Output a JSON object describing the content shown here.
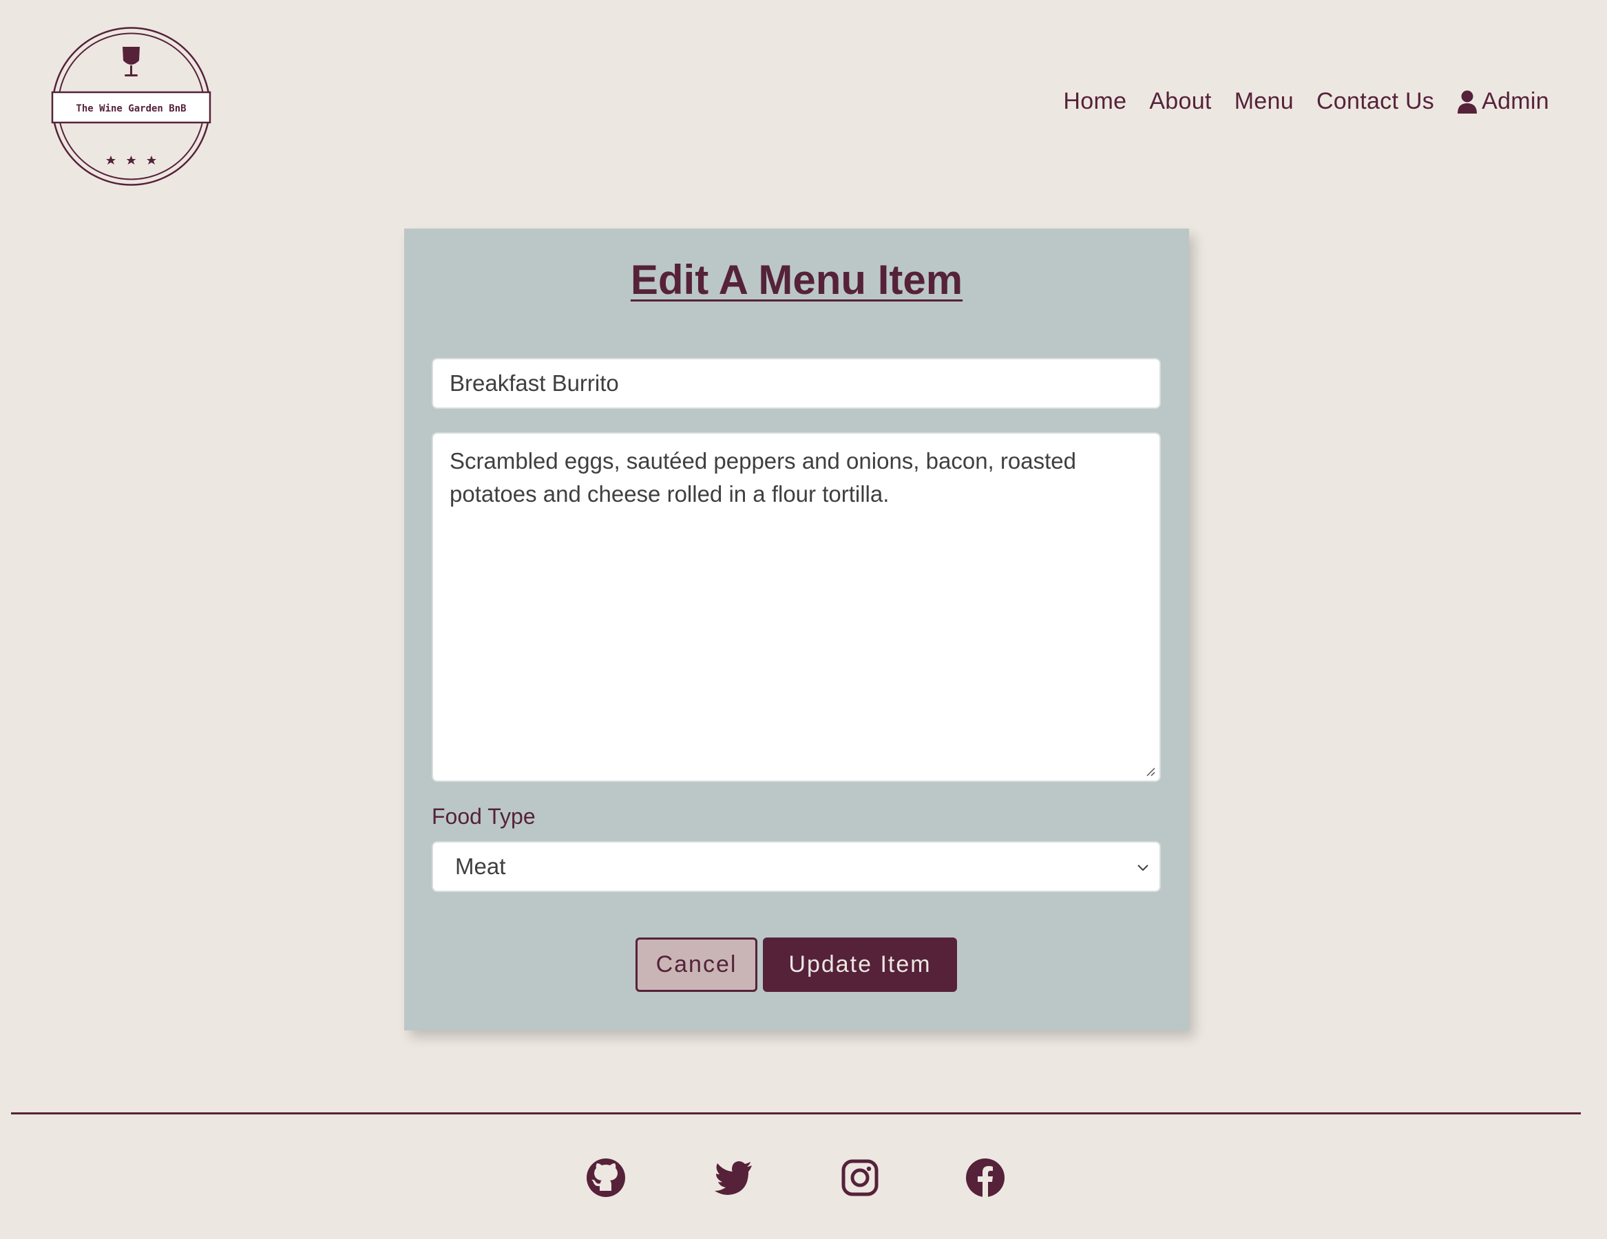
{
  "brand": {
    "logo_text": "The Wine Garden BnB",
    "logo_icon": "wine-glass-icon"
  },
  "nav": {
    "items": [
      "Home",
      "About",
      "Menu",
      "Contact Us"
    ],
    "admin_label": "Admin",
    "admin_icon": "user-icon"
  },
  "form": {
    "title": "Edit A Menu Item",
    "name_value": "Breakfast Burrito",
    "description_value": "Scrambled eggs, sautéed peppers and onions, bacon, roasted potatoes and cheese rolled in a flour tortilla.",
    "food_type_label": "Food Type",
    "food_type_value": "Meat",
    "cancel_label": "Cancel",
    "update_label": "Update Item"
  },
  "footer": {
    "social_icons": [
      "github-icon",
      "twitter-icon",
      "instagram-icon",
      "facebook-icon"
    ]
  },
  "colors": {
    "background": "#ede7e1",
    "card": "#bbc7c7",
    "accent": "#55223a",
    "cancel_bg": "#c9b5b5"
  }
}
